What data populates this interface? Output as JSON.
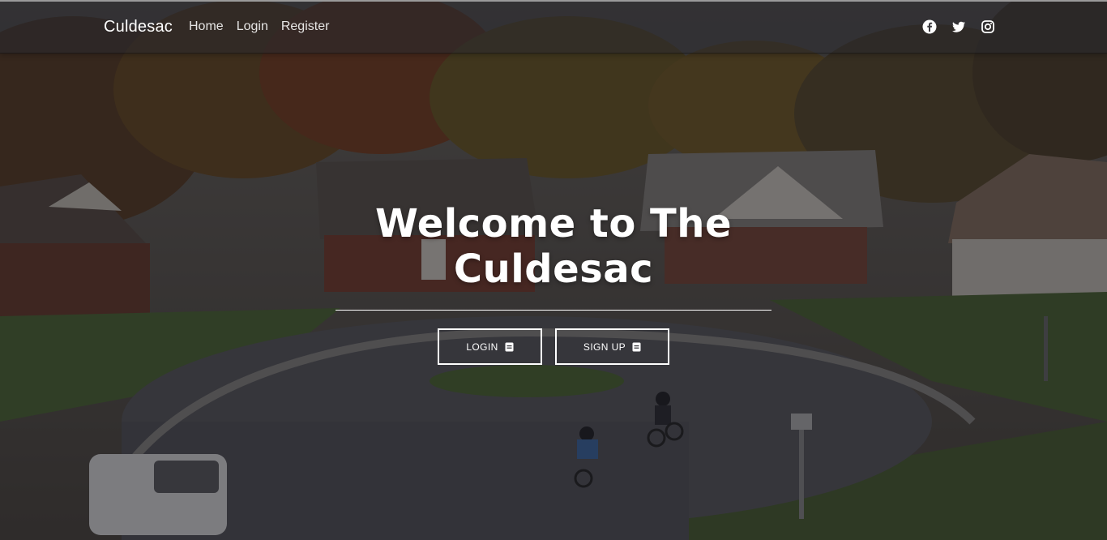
{
  "brand": "Culdesac",
  "nav": {
    "links": [
      "Home",
      "Login",
      "Register"
    ]
  },
  "social": {
    "icons": [
      "facebook-icon",
      "twitter-icon",
      "instagram-icon"
    ]
  },
  "hero": {
    "title": "Welcome to The Culdesac",
    "login_button": "LOGIN",
    "signup_button": "SIGN UP",
    "button_icon": "clipboard-icon"
  },
  "colors": {
    "overlay": "#121218",
    "text": "#ffffff",
    "navbar": "#28282e"
  }
}
